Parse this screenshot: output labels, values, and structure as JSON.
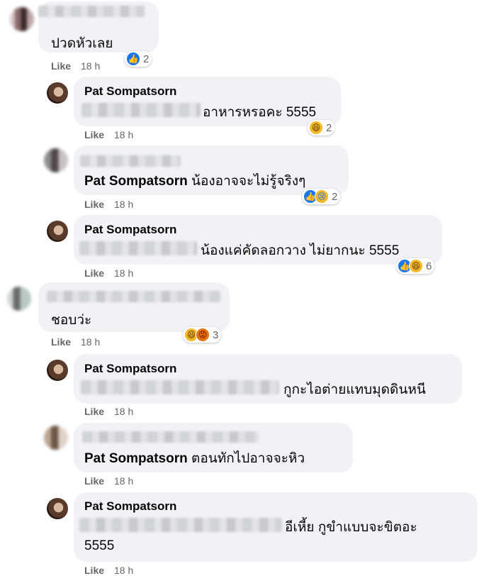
{
  "comments": [
    {
      "text": "ปวดหัวเลย",
      "like_label": "Like",
      "time": "18 h",
      "reaction_count": "2",
      "reaction_icons": [
        "like-icon"
      ]
    },
    {
      "author": "Pat Sompatsorn",
      "text": "อาหารหรอคะ 5555",
      "like_label": "Like",
      "time": "18 h",
      "reaction_count": "2",
      "reaction_icons": [
        "haha-icon"
      ]
    },
    {
      "tagged": "Pat Sompatsorn",
      "text": "น้องอาจจะไม่รู้จริงๆ",
      "like_label": "Like",
      "time": "18 h",
      "reaction_count": "2",
      "reaction_icons": [
        "like-icon",
        "sad-icon"
      ]
    },
    {
      "author": "Pat Sompatsorn",
      "text": "น้องแค่คัดลอกวาง ไม่ยากนะ 5555",
      "like_label": "Like",
      "time": "18 h",
      "reaction_count": "6",
      "reaction_icons": [
        "like-icon",
        "haha-icon"
      ]
    },
    {
      "text": "ชอบว่ะ",
      "like_label": "Like",
      "time": "18 h",
      "reaction_count": "3",
      "reaction_icons": [
        "haha-icon",
        "angry-icon"
      ]
    },
    {
      "author": "Pat Sompatsorn",
      "text": "กูกะไอต่ายแทบมุดดินหนี",
      "like_label": "Like",
      "time": "18 h"
    },
    {
      "tagged": "Pat Sompatsorn",
      "text": "ตอนทักไปอาจจะหิว",
      "like_label": "Like",
      "time": "18 h"
    },
    {
      "author": "Pat Sompatsorn",
      "text_line1": "อีเหี้ย กูขำแบบจะขิตอะ",
      "text_line2": "5555",
      "like_label": "Like",
      "time": "18 h"
    }
  ],
  "reaction_glyphs": {
    "like-icon": "👍",
    "haha-icon": "😆",
    "sad-icon": "😢",
    "angry-icon": "😡"
  },
  "colors": {
    "bubble": "#f0f2f5",
    "meta_text": "#65676b",
    "like_blue": "#1877f2",
    "haha_yellow": "#f7b928",
    "angry_orange": "#e9710f"
  }
}
